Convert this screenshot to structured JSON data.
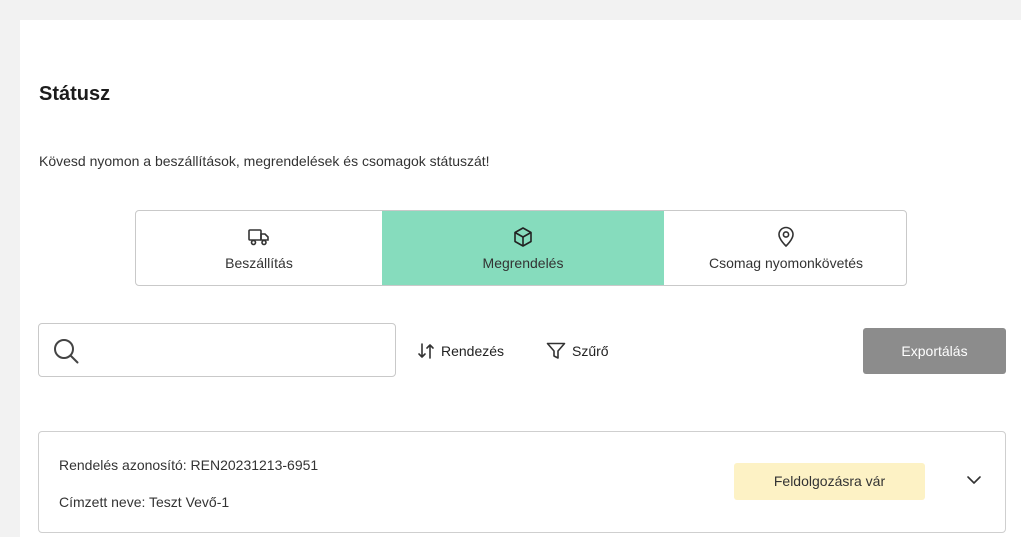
{
  "header": {
    "title": "Státusz",
    "subtitle": "Kövesd nyomon a beszállítások, megrendelések és csomagok státuszát!"
  },
  "tabs": [
    {
      "label": "Beszállítás",
      "icon": "truck-icon",
      "active": false
    },
    {
      "label": "Megrendelés",
      "icon": "box-icon",
      "active": true
    },
    {
      "label": "Csomag nyomonkövetés",
      "icon": "location-pin-icon",
      "active": false
    }
  ],
  "toolbar": {
    "search": {
      "placeholder": "",
      "value": "",
      "icon": "search-icon"
    },
    "sort_label": "Rendezés",
    "filter_label": "Szűrő",
    "export_label": "Exportálás"
  },
  "orders": [
    {
      "order_id": "Rendelés azonosító: REN20231213-6951",
      "recipient": "Címzett neve: Teszt Vevő-1",
      "status": "Feldolgozásra vár",
      "status_color": "#fdf2c5"
    }
  ],
  "colors": {
    "active_tab": "#86dcbd",
    "export_button": "#8c8c8c",
    "status_pending": "#fdf2c5"
  }
}
